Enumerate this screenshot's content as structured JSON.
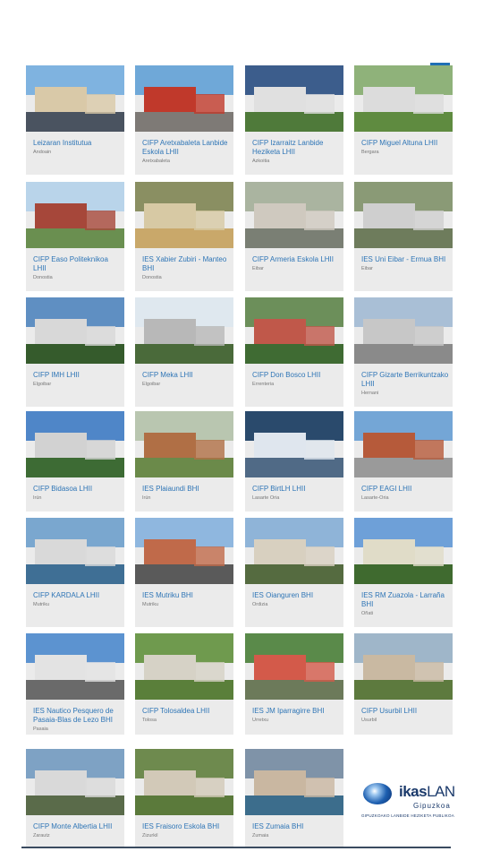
{
  "colors": {
    "name_link": "#2e75b6",
    "card_bg": "#ebebeb",
    "town_text": "#777777"
  },
  "schools": [
    {
      "name": "Leizaran Institutua",
      "town": "Andoain",
      "photo": {
        "sky": "#7fb3e0",
        "ground": "#4a5360",
        "bldg": "#d9c9a8"
      }
    },
    {
      "name": "CIFP Aretxabaleta Lanbide Eskola LHII",
      "town": "Aretxabaleta",
      "photo": {
        "sky": "#6fa8d8",
        "ground": "#7e7a76",
        "bldg": "#c0392b"
      }
    },
    {
      "name": "CIFP Izarraitz Lanbide Heziketa LHII",
      "town": "Azkoitia",
      "photo": {
        "sky": "#3c5d8c",
        "ground": "#4f7a3a",
        "bldg": "#e0e0e0"
      }
    },
    {
      "name": "CIFP Miguel Altuna LHII",
      "town": "Bergara",
      "photo": {
        "sky": "#8fb27a",
        "ground": "#5f8b40",
        "bldg": "#dcdcdc"
      }
    },
    {
      "name": "CIFP Easo Politeknikoa LHII",
      "town": "Donostia",
      "photo": {
        "sky": "#b9d4ea",
        "ground": "#6a8f50",
        "bldg": "#a6473a"
      }
    },
    {
      "name": "IES Xabier Zubiri - Manteo BHI",
      "town": "Donostia",
      "photo": {
        "sky": "#8a8f62",
        "ground": "#c9a86a",
        "bldg": "#d7c9a4"
      }
    },
    {
      "name": "CIFP Armeria Eskola LHII",
      "town": "Eibar",
      "photo": {
        "sky": "#aab4a0",
        "ground": "#7a7f74",
        "bldg": "#cfc9bf"
      }
    },
    {
      "name": "IES Uni Eibar - Ermua BHI",
      "town": "Eibar",
      "photo": {
        "sky": "#8a9a76",
        "ground": "#6e7c5c",
        "bldg": "#cfcfcf"
      }
    },
    {
      "name": "CIFP IMH LHII",
      "town": "Elgoibar",
      "photo": {
        "sky": "#5f8fc2",
        "ground": "#355b2c",
        "bldg": "#d8d8d8"
      }
    },
    {
      "name": "CIFP Meka LHII",
      "town": "Elgoibar",
      "photo": {
        "sky": "#dfe8ef",
        "ground": "#4a6a3a",
        "bldg": "#b8b8b8"
      }
    },
    {
      "name": "CIFP Don Bosco LHII",
      "town": "Errenteria",
      "photo": {
        "sky": "#6c8f5a",
        "ground": "#3f6b33",
        "bldg": "#c0584a"
      }
    },
    {
      "name": "CIFP Gizarte Berrikuntzako LHII",
      "town": "Hernani",
      "photo": {
        "sky": "#a9bfd6",
        "ground": "#8a8a8a",
        "bldg": "#c7c7c7"
      }
    },
    {
      "name": "CIFP Bidasoa LHII",
      "town": "Irún",
      "photo": {
        "sky": "#4f86c8",
        "ground": "#3d6b34",
        "bldg": "#d2d2d2"
      }
    },
    {
      "name": "IES Plaiaundi BHI",
      "town": "Irún",
      "photo": {
        "sky": "#b9c6b0",
        "ground": "#6b8a4a",
        "bldg": "#b06f45"
      }
    },
    {
      "name": "CIFP BirtLH LHII",
      "town": "Lasarte Oria",
      "photo": {
        "sky": "#2a4a6c",
        "ground": "#506a86",
        "bldg": "#dfe6ee"
      }
    },
    {
      "name": "CIFP EAGI LHII",
      "town": "Lasarte-Oria",
      "photo": {
        "sky": "#74a6d6",
        "ground": "#9a9a9a",
        "bldg": "#b65a3a"
      }
    },
    {
      "name": "CIFP KARDALA LHII",
      "town": "Mutriku",
      "photo": {
        "sky": "#7aa7cf",
        "ground": "#3f6f95",
        "bldg": "#d9d9d9"
      }
    },
    {
      "name": "IES Mutriku BHI",
      "town": "Mutriku",
      "photo": {
        "sky": "#8fb7df",
        "ground": "#5a5a5a",
        "bldg": "#c06a4a"
      }
    },
    {
      "name": "IES Oianguren BHI",
      "town": "Ordizia",
      "photo": {
        "sky": "#8fb4d8",
        "ground": "#556b40",
        "bldg": "#d8d0c0"
      }
    },
    {
      "name": "IES RM Zuazola - Larraña BHI",
      "town": "Oñati",
      "photo": {
        "sky": "#6ea0d8",
        "ground": "#3f6a2f",
        "bldg": "#e0dcc8"
      }
    },
    {
      "name": "IES Nautico Pesquero de Pasaia-Blas de Lezo BHI",
      "town": "Pasaia",
      "photo": {
        "sky": "#5c93d0",
        "ground": "#6a6a6a",
        "bldg": "#e3e3e3"
      }
    },
    {
      "name": "CIFP Tolosaldea LHII",
      "town": "Tolosa",
      "photo": {
        "sky": "#6f9a4e",
        "ground": "#5a7f3a",
        "bldg": "#d6d2c6"
      }
    },
    {
      "name": "IES JM Iparragirre BHI",
      "town": "Urretxu",
      "photo": {
        "sky": "#5a8a4a",
        "ground": "#6c7a5a",
        "bldg": "#d35a4a"
      }
    },
    {
      "name": "CIFP Usurbil LHII",
      "town": "Usurbil",
      "photo": {
        "sky": "#9fb6c9",
        "ground": "#5d7a3e",
        "bldg": "#c9b9a2"
      }
    },
    {
      "name": "CIFP Monte Albertia LHII",
      "town": "Zarautz",
      "photo": {
        "sky": "#7ea2c4",
        "ground": "#5a6b4a",
        "bldg": "#d9d9d9"
      }
    },
    {
      "name": "IES Fraisoro Eskola BHI",
      "town": "Zizurkil",
      "photo": {
        "sky": "#6e8a4e",
        "ground": "#5b7a3b",
        "bldg": "#d2c9b8"
      }
    },
    {
      "name": "IES Zumaia BHI",
      "town": "Zumaia",
      "photo": {
        "sky": "#7f93a8",
        "ground": "#3c6d8c",
        "bldg": "#c9b7a1"
      }
    }
  ],
  "logo": {
    "word1": "ikas",
    "word2": "LAN",
    "region": "Gipuzkoa",
    "subtitle": "GIPUZKOAKO LANBIDE HEZIKETA PUBLIKOA"
  }
}
